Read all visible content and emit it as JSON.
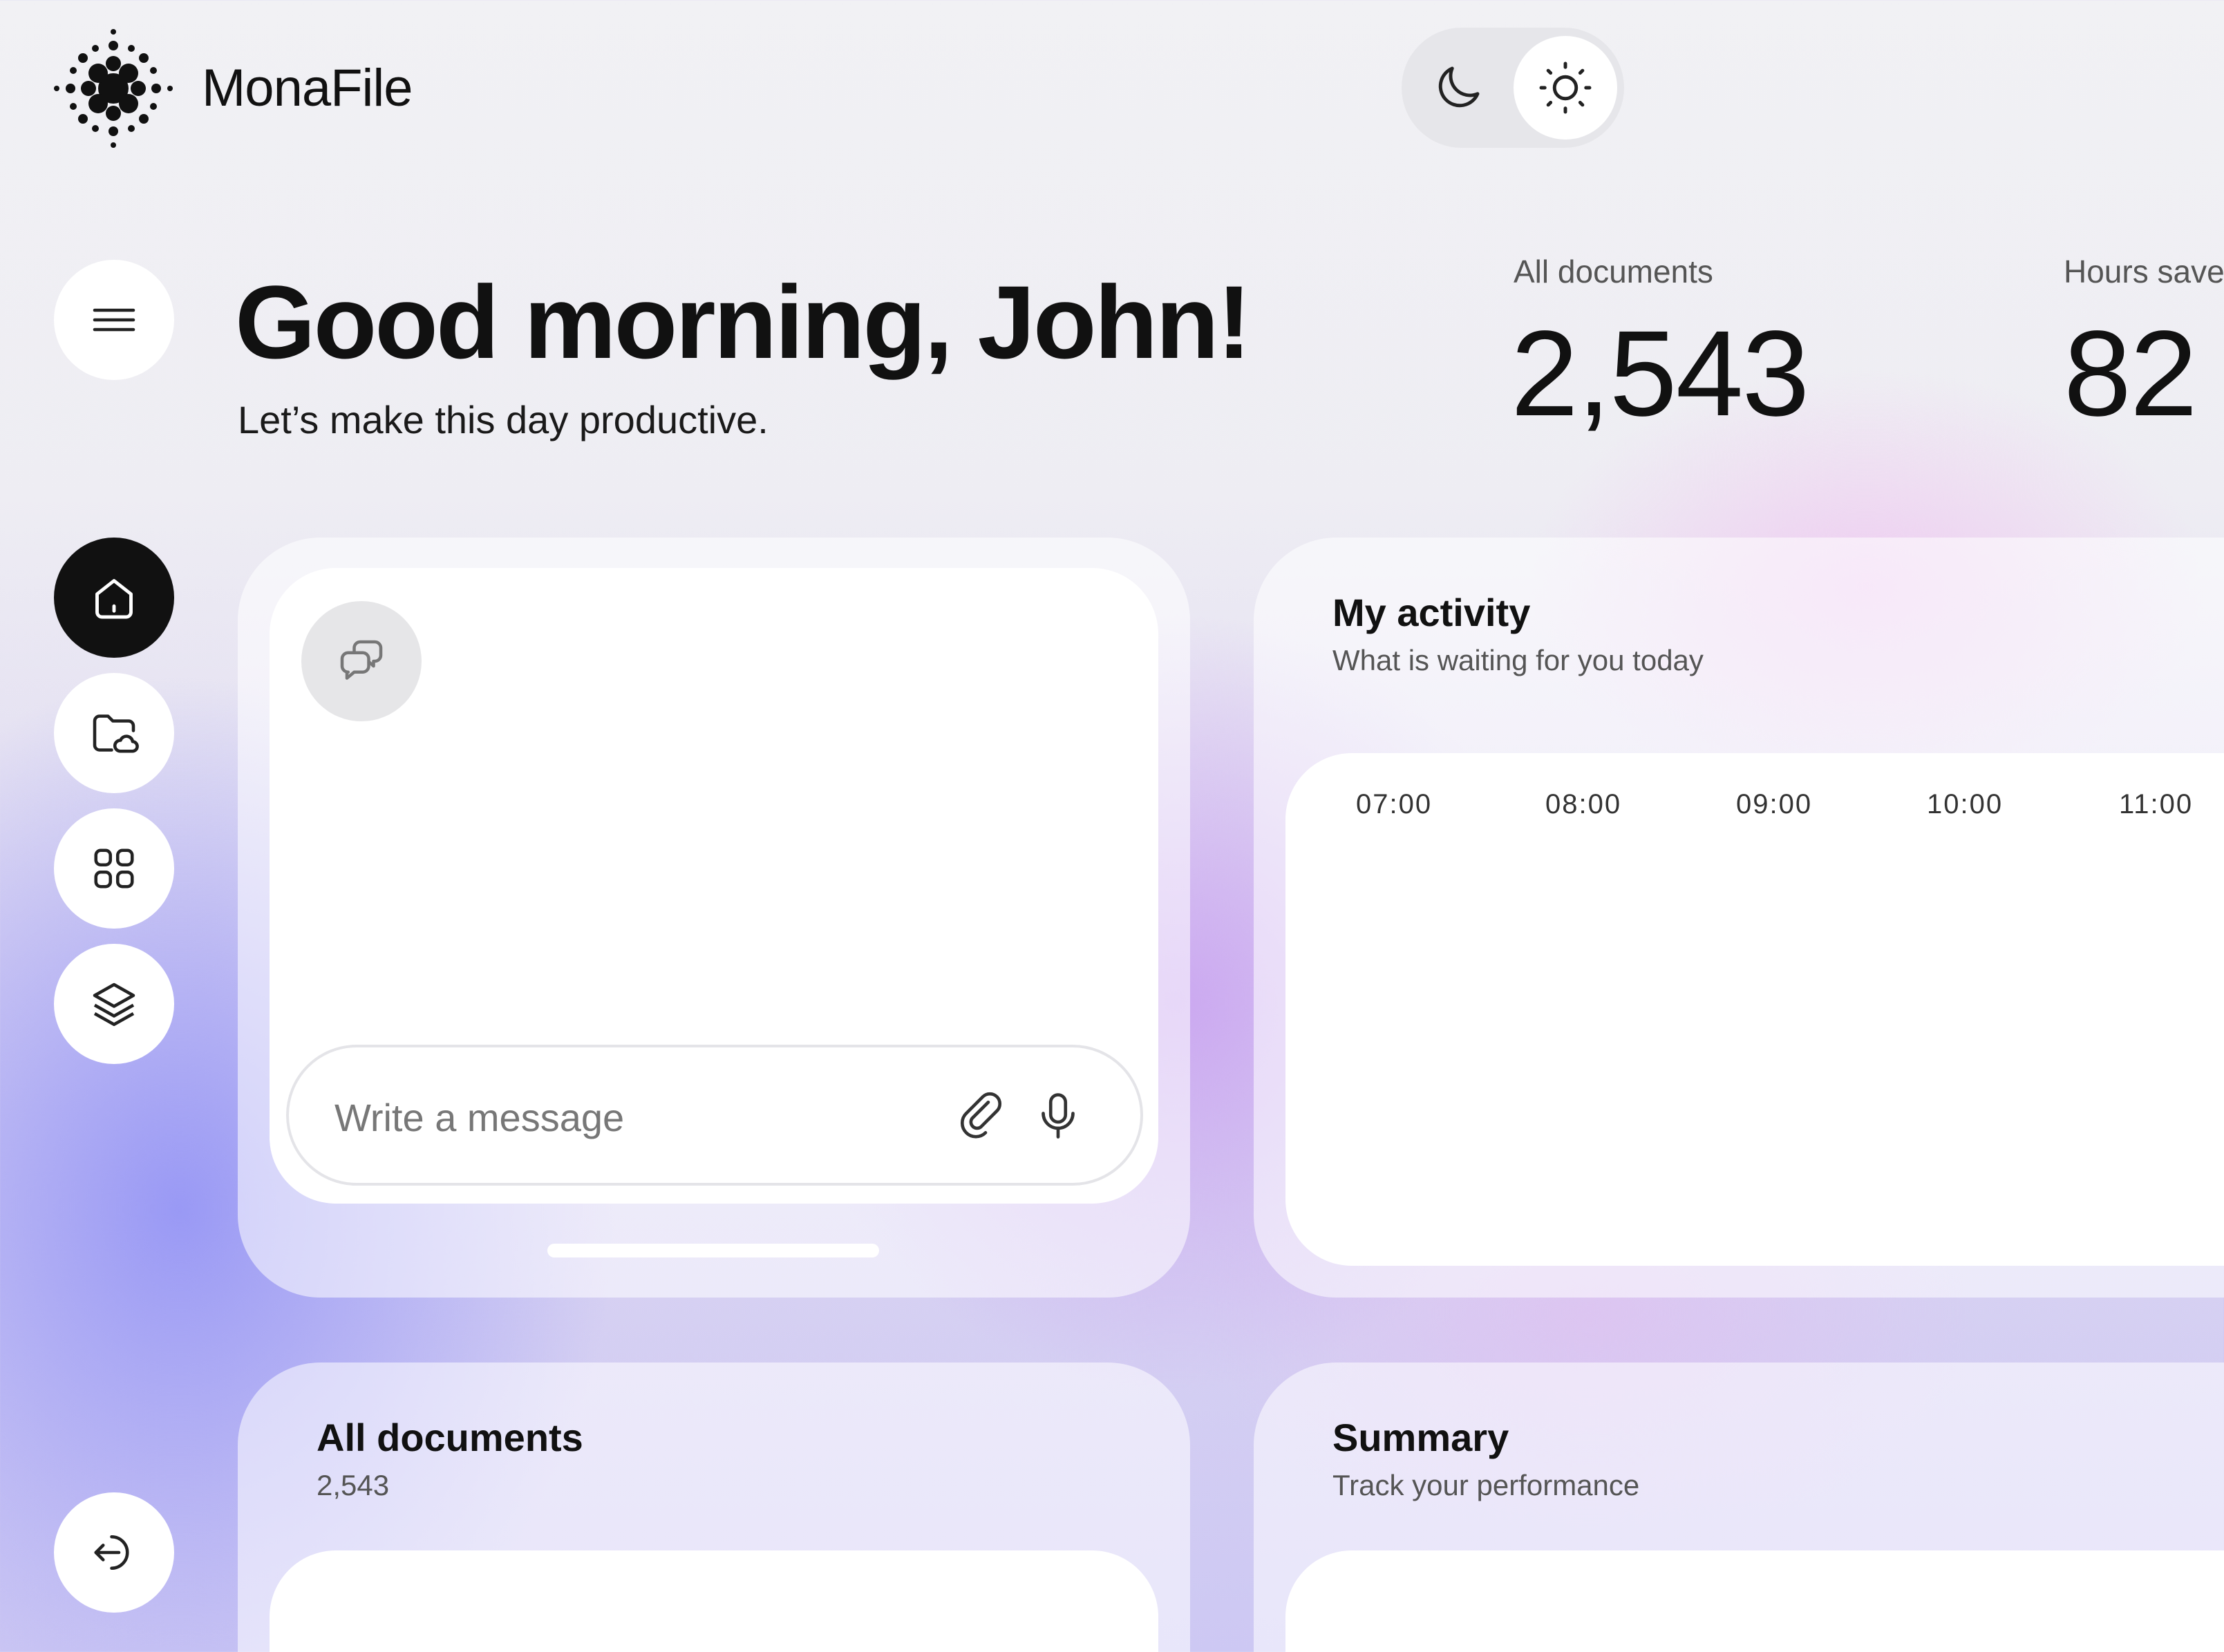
{
  "app": {
    "name": "MonaFile"
  },
  "theme": {
    "dark_icon": "moon-icon",
    "light_icon": "sun-icon",
    "active": "light"
  },
  "header": {
    "greeting": "Good morning, John!",
    "subtitle": "Let’s make this day productive."
  },
  "stats": [
    {
      "label": "All documents",
      "value": "2,543"
    },
    {
      "label": "Hours save",
      "value": "82"
    }
  ],
  "sidebar": {
    "menu_icon": "hamburger-icon",
    "items": [
      {
        "name": "home",
        "icon": "home-icon",
        "active": true
      },
      {
        "name": "folders",
        "icon": "cloud-folder-icon",
        "active": false
      },
      {
        "name": "apps",
        "icon": "grid-icon",
        "active": false
      },
      {
        "name": "layers",
        "icon": "layers-icon",
        "active": false
      }
    ],
    "logout_icon": "logout-icon"
  },
  "chat": {
    "icon": "chat-bubbles-icon",
    "placeholder": "Write a message",
    "attach_icon": "paperclip-icon",
    "mic_icon": "microphone-icon"
  },
  "activity": {
    "title": "My activity",
    "subtitle": "What is waiting for you today",
    "times": [
      "07:00",
      "08:00",
      "09:00",
      "10:00",
      "11:00"
    ]
  },
  "documents": {
    "title": "All documents",
    "count": "2,543"
  },
  "summary": {
    "title": "Summary",
    "subtitle": "Track your performance"
  },
  "colors": {
    "accent_dark": "#111111",
    "panel": "#ffffff",
    "gradient_blue": "#9a9af5",
    "gradient_purple": "#c8a0f0",
    "gradient_pink": "#f0bef0"
  }
}
